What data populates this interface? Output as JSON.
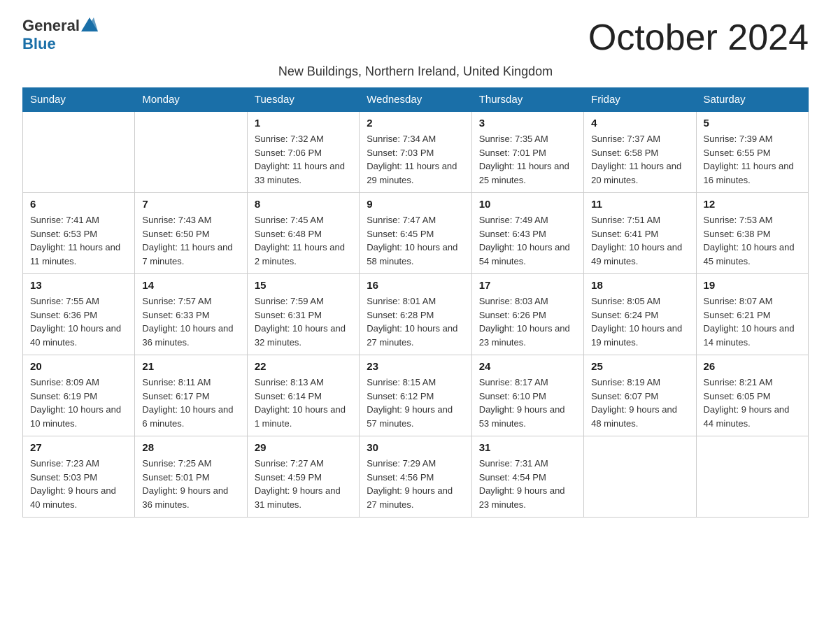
{
  "header": {
    "logo_general": "General",
    "logo_blue": "Blue",
    "month_title": "October 2024",
    "subtitle": "New Buildings, Northern Ireland, United Kingdom"
  },
  "weekdays": [
    "Sunday",
    "Monday",
    "Tuesday",
    "Wednesday",
    "Thursday",
    "Friday",
    "Saturday"
  ],
  "weeks": [
    [
      {
        "day": "",
        "sunrise": "",
        "sunset": "",
        "daylight": ""
      },
      {
        "day": "",
        "sunrise": "",
        "sunset": "",
        "daylight": ""
      },
      {
        "day": "1",
        "sunrise": "Sunrise: 7:32 AM",
        "sunset": "Sunset: 7:06 PM",
        "daylight": "Daylight: 11 hours and 33 minutes."
      },
      {
        "day": "2",
        "sunrise": "Sunrise: 7:34 AM",
        "sunset": "Sunset: 7:03 PM",
        "daylight": "Daylight: 11 hours and 29 minutes."
      },
      {
        "day": "3",
        "sunrise": "Sunrise: 7:35 AM",
        "sunset": "Sunset: 7:01 PM",
        "daylight": "Daylight: 11 hours and 25 minutes."
      },
      {
        "day": "4",
        "sunrise": "Sunrise: 7:37 AM",
        "sunset": "Sunset: 6:58 PM",
        "daylight": "Daylight: 11 hours and 20 minutes."
      },
      {
        "day": "5",
        "sunrise": "Sunrise: 7:39 AM",
        "sunset": "Sunset: 6:55 PM",
        "daylight": "Daylight: 11 hours and 16 minutes."
      }
    ],
    [
      {
        "day": "6",
        "sunrise": "Sunrise: 7:41 AM",
        "sunset": "Sunset: 6:53 PM",
        "daylight": "Daylight: 11 hours and 11 minutes."
      },
      {
        "day": "7",
        "sunrise": "Sunrise: 7:43 AM",
        "sunset": "Sunset: 6:50 PM",
        "daylight": "Daylight: 11 hours and 7 minutes."
      },
      {
        "day": "8",
        "sunrise": "Sunrise: 7:45 AM",
        "sunset": "Sunset: 6:48 PM",
        "daylight": "Daylight: 11 hours and 2 minutes."
      },
      {
        "day": "9",
        "sunrise": "Sunrise: 7:47 AM",
        "sunset": "Sunset: 6:45 PM",
        "daylight": "Daylight: 10 hours and 58 minutes."
      },
      {
        "day": "10",
        "sunrise": "Sunrise: 7:49 AM",
        "sunset": "Sunset: 6:43 PM",
        "daylight": "Daylight: 10 hours and 54 minutes."
      },
      {
        "day": "11",
        "sunrise": "Sunrise: 7:51 AM",
        "sunset": "Sunset: 6:41 PM",
        "daylight": "Daylight: 10 hours and 49 minutes."
      },
      {
        "day": "12",
        "sunrise": "Sunrise: 7:53 AM",
        "sunset": "Sunset: 6:38 PM",
        "daylight": "Daylight: 10 hours and 45 minutes."
      }
    ],
    [
      {
        "day": "13",
        "sunrise": "Sunrise: 7:55 AM",
        "sunset": "Sunset: 6:36 PM",
        "daylight": "Daylight: 10 hours and 40 minutes."
      },
      {
        "day": "14",
        "sunrise": "Sunrise: 7:57 AM",
        "sunset": "Sunset: 6:33 PM",
        "daylight": "Daylight: 10 hours and 36 minutes."
      },
      {
        "day": "15",
        "sunrise": "Sunrise: 7:59 AM",
        "sunset": "Sunset: 6:31 PM",
        "daylight": "Daylight: 10 hours and 32 minutes."
      },
      {
        "day": "16",
        "sunrise": "Sunrise: 8:01 AM",
        "sunset": "Sunset: 6:28 PM",
        "daylight": "Daylight: 10 hours and 27 minutes."
      },
      {
        "day": "17",
        "sunrise": "Sunrise: 8:03 AM",
        "sunset": "Sunset: 6:26 PM",
        "daylight": "Daylight: 10 hours and 23 minutes."
      },
      {
        "day": "18",
        "sunrise": "Sunrise: 8:05 AM",
        "sunset": "Sunset: 6:24 PM",
        "daylight": "Daylight: 10 hours and 19 minutes."
      },
      {
        "day": "19",
        "sunrise": "Sunrise: 8:07 AM",
        "sunset": "Sunset: 6:21 PM",
        "daylight": "Daylight: 10 hours and 14 minutes."
      }
    ],
    [
      {
        "day": "20",
        "sunrise": "Sunrise: 8:09 AM",
        "sunset": "Sunset: 6:19 PM",
        "daylight": "Daylight: 10 hours and 10 minutes."
      },
      {
        "day": "21",
        "sunrise": "Sunrise: 8:11 AM",
        "sunset": "Sunset: 6:17 PM",
        "daylight": "Daylight: 10 hours and 6 minutes."
      },
      {
        "day": "22",
        "sunrise": "Sunrise: 8:13 AM",
        "sunset": "Sunset: 6:14 PM",
        "daylight": "Daylight: 10 hours and 1 minute."
      },
      {
        "day": "23",
        "sunrise": "Sunrise: 8:15 AM",
        "sunset": "Sunset: 6:12 PM",
        "daylight": "Daylight: 9 hours and 57 minutes."
      },
      {
        "day": "24",
        "sunrise": "Sunrise: 8:17 AM",
        "sunset": "Sunset: 6:10 PM",
        "daylight": "Daylight: 9 hours and 53 minutes."
      },
      {
        "day": "25",
        "sunrise": "Sunrise: 8:19 AM",
        "sunset": "Sunset: 6:07 PM",
        "daylight": "Daylight: 9 hours and 48 minutes."
      },
      {
        "day": "26",
        "sunrise": "Sunrise: 8:21 AM",
        "sunset": "Sunset: 6:05 PM",
        "daylight": "Daylight: 9 hours and 44 minutes."
      }
    ],
    [
      {
        "day": "27",
        "sunrise": "Sunrise: 7:23 AM",
        "sunset": "Sunset: 5:03 PM",
        "daylight": "Daylight: 9 hours and 40 minutes."
      },
      {
        "day": "28",
        "sunrise": "Sunrise: 7:25 AM",
        "sunset": "Sunset: 5:01 PM",
        "daylight": "Daylight: 9 hours and 36 minutes."
      },
      {
        "day": "29",
        "sunrise": "Sunrise: 7:27 AM",
        "sunset": "Sunset: 4:59 PM",
        "daylight": "Daylight: 9 hours and 31 minutes."
      },
      {
        "day": "30",
        "sunrise": "Sunrise: 7:29 AM",
        "sunset": "Sunset: 4:56 PM",
        "daylight": "Daylight: 9 hours and 27 minutes."
      },
      {
        "day": "31",
        "sunrise": "Sunrise: 7:31 AM",
        "sunset": "Sunset: 4:54 PM",
        "daylight": "Daylight: 9 hours and 23 minutes."
      },
      {
        "day": "",
        "sunrise": "",
        "sunset": "",
        "daylight": ""
      },
      {
        "day": "",
        "sunrise": "",
        "sunset": "",
        "daylight": ""
      }
    ]
  ]
}
